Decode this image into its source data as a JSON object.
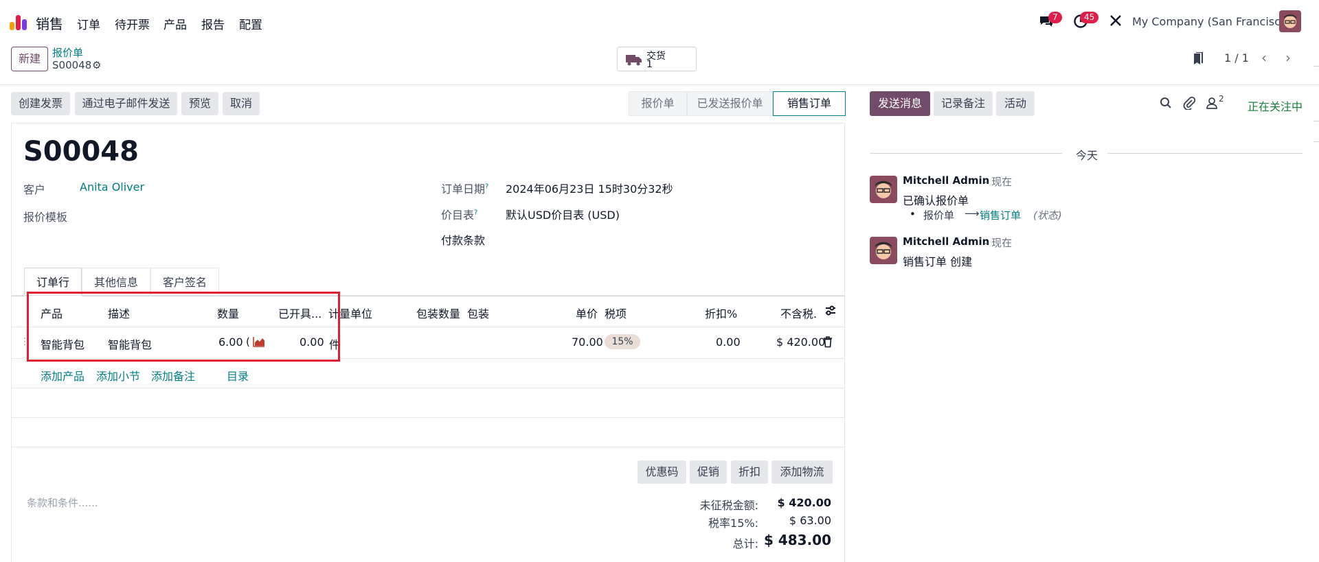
{
  "nav": {
    "app_name": "销售",
    "menu": [
      "订单",
      "待开票",
      "产品",
      "报告",
      "配置"
    ],
    "messages_badge": "7",
    "activities_badge": "45",
    "company": "My Company (San Francisco)"
  },
  "control": {
    "new_label": "新建",
    "breadcrumb": "报价单",
    "record": "S00048",
    "smart_label": "交货",
    "smart_count": "1",
    "pager": "1 / 1"
  },
  "actions": [
    "创建发票",
    "通过电子邮件发送",
    "预览",
    "取消"
  ],
  "statusbar": [
    "报价单",
    "已发送报价单",
    "销售订单"
  ],
  "form": {
    "title": "S00048",
    "customer_label": "客户",
    "customer_value": "Anita Oliver",
    "template_label": "报价模板",
    "date_label": "订单日期",
    "date_value": "2024年06月23日 15时30分32秒",
    "pricelist_label": "价目表",
    "pricelist_value": "默认USD价目表 (USD)",
    "payment_label": "付款条款",
    "help_mark": "?"
  },
  "tabs": [
    "订单行",
    "其他信息",
    "客户签名"
  ],
  "table": {
    "headers": [
      "产品",
      "描述",
      "数量",
      "已开具...",
      "计量单位",
      "包装数量",
      "包装",
      "单价",
      "税项",
      "折扣%",
      "不含税."
    ],
    "row": {
      "product": "智能背包",
      "description": "智能背包",
      "quantity": "6.00",
      "invoiced": "0.00",
      "uom": "件",
      "price": "70.00",
      "tax": "15%",
      "discount": "0.00",
      "subtotal": "$ 420.00"
    },
    "add_links": [
      "添加产品",
      "添加小节",
      "添加备注",
      "目录"
    ]
  },
  "footer": {
    "buttons": [
      "优惠码",
      "促销",
      "折扣",
      "添加物流"
    ],
    "terms_placeholder": "条款和条件......",
    "untaxed_label": "未征税金额:",
    "untaxed_value": "$ 420.00",
    "tax_label": "税率15%:",
    "tax_value": "$ 63.00",
    "total_label": "总计:",
    "total_value": "$ 483.00"
  },
  "chatter": {
    "send_message": "发送消息",
    "log_note": "记录备注",
    "activity": "活动",
    "followers_count": "2",
    "following": "正在关注中",
    "today": "今天",
    "messages": [
      {
        "author": "Mitchell Admin",
        "when": "- 现在",
        "body": "已确认报价单",
        "change_from": "报价单",
        "arrow": "⟶",
        "change_to": "销售订单",
        "field": "(状态)"
      },
      {
        "author": "Mitchell Admin",
        "when": "- 现在",
        "body": "销售订单 创建"
      }
    ]
  },
  "colors": {
    "brand": "#714b67",
    "link": "#017e84",
    "highlight_box": "#e11d2e",
    "following": "#15803d"
  }
}
